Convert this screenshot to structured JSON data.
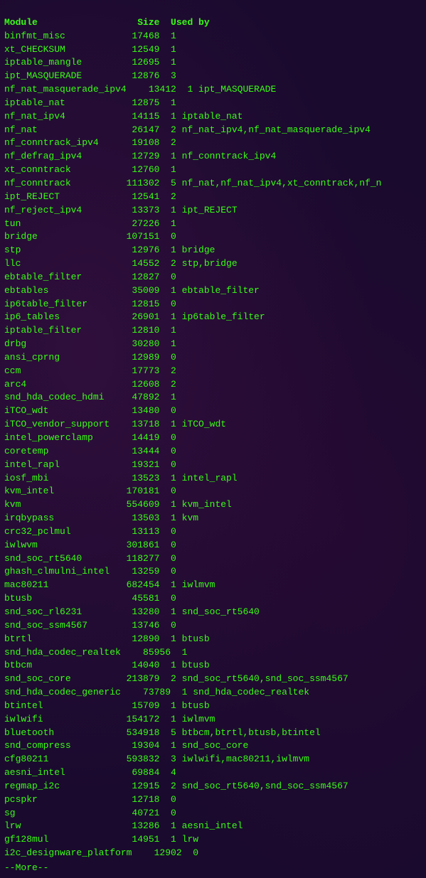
{
  "terminal": {
    "header": "Module                  Size  Used by",
    "rows": [
      "binfmt_misc            17468  1",
      "xt_CHECKSUM            12549  1",
      "iptable_mangle         12695  1",
      "ipt_MASQUERADE         12876  3",
      "nf_nat_masquerade_ipv4    13412  1 ipt_MASQUERADE",
      "iptable_nat            12875  1",
      "nf_nat_ipv4            14115  1 iptable_nat",
      "nf_nat                 26147  2 nf_nat_ipv4,nf_nat_masquerade_ipv4",
      "nf_conntrack_ipv4      19108  2",
      "nf_defrag_ipv4         12729  1 nf_conntrack_ipv4",
      "xt_conntrack           12760  1",
      "nf_conntrack          111302  5 nf_nat,nf_nat_ipv4,xt_conntrack,nf_n",
      "ipt_REJECT             12541  2",
      "nf_reject_ipv4         13373  1 ipt_REJECT",
      "tun                    27226  1",
      "bridge                107151  0",
      "stp                    12976  1 bridge",
      "llc                    14552  2 stp,bridge",
      "ebtable_filter         12827  0",
      "ebtables               35009  1 ebtable_filter",
      "ip6table_filter        12815  0",
      "ip6_tables             26901  1 ip6table_filter",
      "iptable_filter         12810  1",
      "drbg                   30280  1",
      "ansi_cprng             12989  0",
      "ccm                    17773  2",
      "arc4                   12608  2",
      "snd_hda_codec_hdmi     47892  1",
      "iTCO_wdt               13480  0",
      "iTCO_vendor_support    13718  1 iTCO_wdt",
      "intel_powerclamp       14419  0",
      "coretemp               13444  0",
      "intel_rapl             19321  0",
      "iosf_mbi               13523  1 intel_rapl",
      "kvm_intel             170181  0",
      "kvm                   554609  1 kvm_intel",
      "irqbypass              13503  1 kvm",
      "crc32_pclmul           13113  0",
      "iwlwvm                301861  0",
      "snd_soc_rt5640        118277  0",
      "ghash_clmulni_intel    13259  0",
      "mac80211              682454  1 iwlmvm",
      "btusb                  45581  0",
      "snd_soc_rl6231         13280  1 snd_soc_rt5640",
      "snd_soc_ssm4567        13746  0",
      "btrtl                  12890  1 btusb",
      "snd_hda_codec_realtek    85956  1",
      "btbcm                  14040  1 btusb",
      "snd_soc_core          213879  2 snd_soc_rt5640,snd_soc_ssm4567",
      "snd_hda_codec_generic    73789  1 snd_hda_codec_realtek",
      "btintel                15709  1 btusb",
      "iwlwifi               154172  1 iwlmvm",
      "bluetooth             534918  5 btbcm,btrtl,btusb,btintel",
      "snd_compress           19304  1 snd_soc_core",
      "cfg80211              593832  3 iwlwifi,mac80211,iwlmvm",
      "aesni_intel            69884  4",
      "regmap_i2c             12915  2 snd_soc_rt5640,snd_soc_ssm4567",
      "pcspkr                 12718  0",
      "sg                     40721  0",
      "lrw                    13286  1 aesni_intel",
      "gf128mul               14951  1 lrw",
      "i2c_designware_platform    12902  0"
    ],
    "more_prompt": "--More--"
  }
}
